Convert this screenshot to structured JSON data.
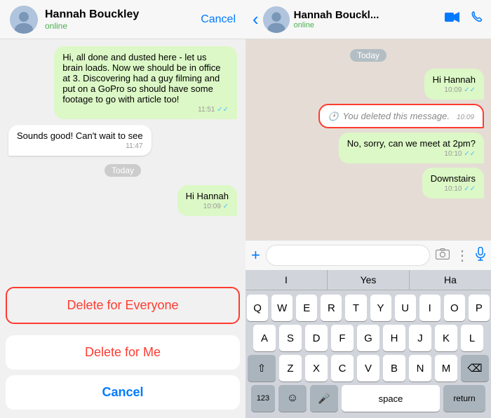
{
  "left": {
    "header": {
      "name": "Hannah Bouckley",
      "status": "online",
      "cancel_label": "Cancel"
    },
    "messages": [
      {
        "type": "right",
        "text": "Hi, all done and dusted here - let us brain loads. Now we should be in office at 3. Discovering had a guy filming and put on a GoPro so should have some footage to go with article too!",
        "time": "11:51",
        "ticks": "✓✓"
      },
      {
        "type": "left",
        "text": "Sounds good! Can't wait to see",
        "time": "11:47"
      }
    ],
    "date_divider": "Today",
    "after_divider": {
      "type": "right",
      "text": "Hi Hannah",
      "time": "10:09",
      "ticks": "✓"
    },
    "action_sheet": {
      "delete_everyone": "Delete for Everyone",
      "delete_me": "Delete for Me",
      "cancel": "Cancel"
    }
  },
  "right": {
    "header": {
      "name": "Hannah Bouckl...",
      "status": "online",
      "back_icon": "‹",
      "video_icon": "□",
      "phone_icon": "✆"
    },
    "messages": [
      {
        "type": "date",
        "text": "Today"
      },
      {
        "type": "right",
        "text": "Hi Hannah",
        "time": "10:09",
        "ticks": "✓✓"
      },
      {
        "type": "deleted",
        "text": "You deleted this message.",
        "time": "10:09"
      },
      {
        "type": "right",
        "text": "No, sorry, can we meet at 2pm?",
        "time": "10:10",
        "ticks": "✓✓"
      },
      {
        "type": "right",
        "text": "Downstairs",
        "time": "10:10",
        "ticks": "✓✓"
      }
    ],
    "input": {
      "placeholder": ""
    },
    "keyboard": {
      "suggestions": [
        "I",
        "Yes",
        "Ha"
      ],
      "rows": [
        [
          "Q",
          "W",
          "E",
          "R",
          "T",
          "Y",
          "U",
          "I",
          "O",
          "P"
        ],
        [
          "A",
          "S",
          "D",
          "F",
          "G",
          "H",
          "J",
          "K",
          "L"
        ],
        [
          "Z",
          "X",
          "C",
          "V",
          "B",
          "N",
          "M"
        ],
        [
          "123",
          "☺",
          "🎤",
          "space",
          "return"
        ]
      ]
    }
  }
}
